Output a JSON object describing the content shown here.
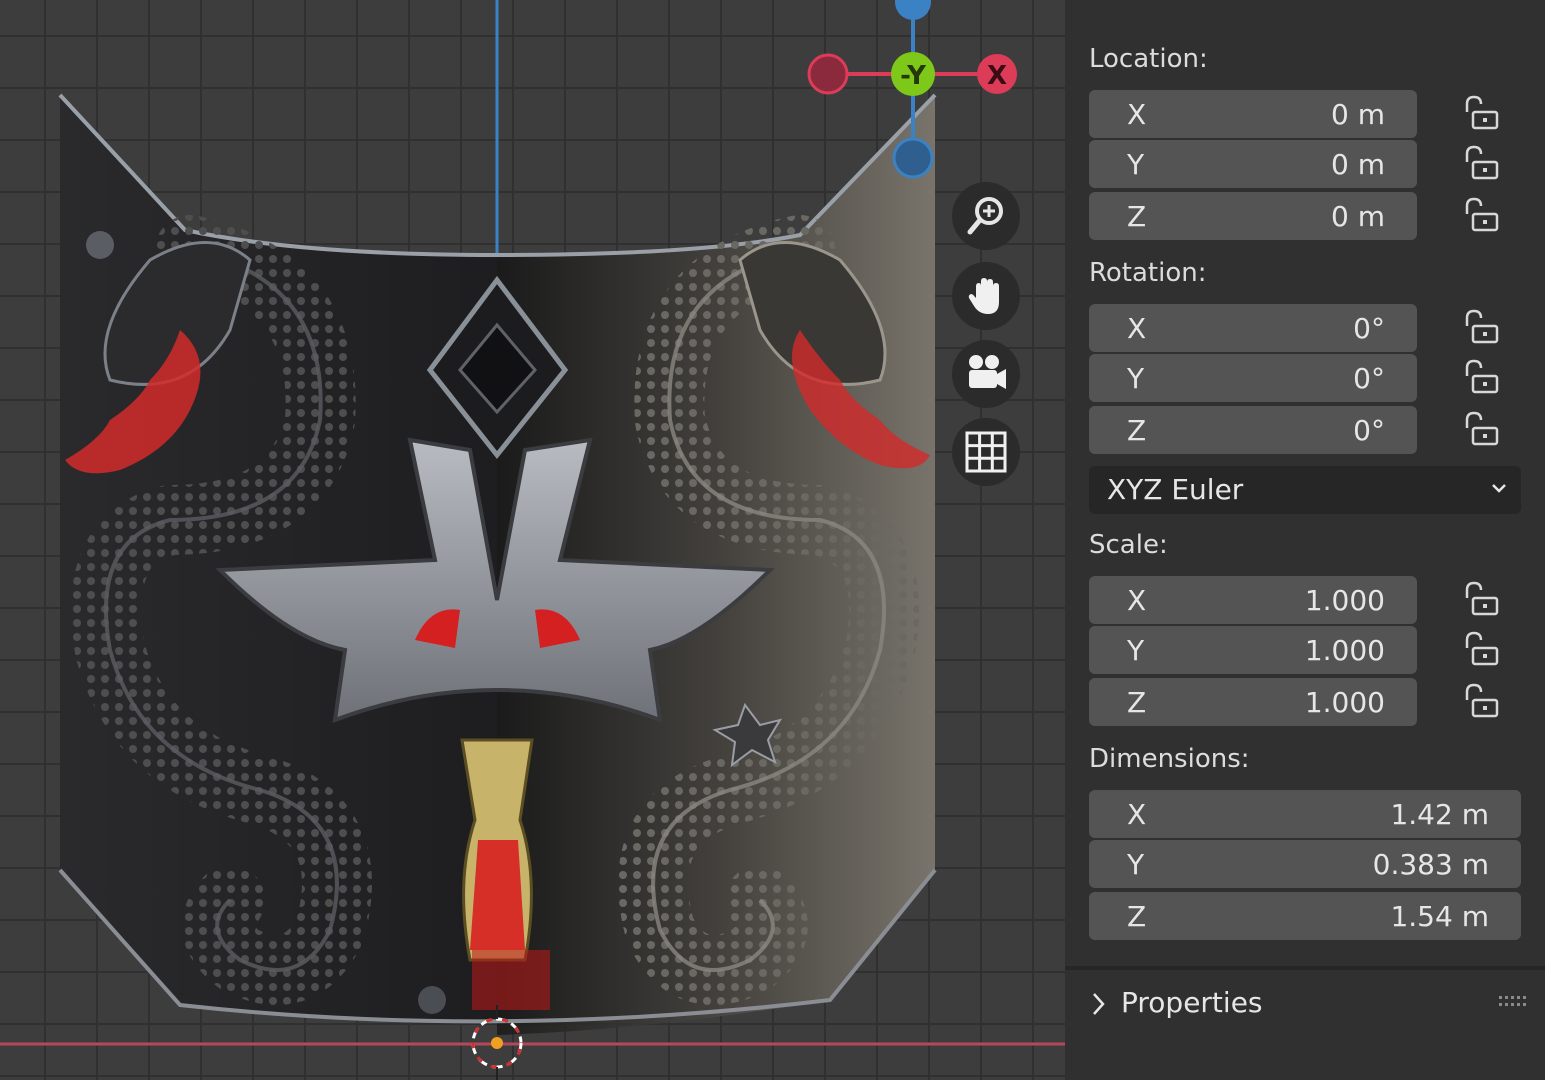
{
  "viewport": {
    "gizmo": {
      "x_label": "X",
      "y_label": "-Y"
    },
    "nav_buttons": [
      {
        "icon": "zoom-icon"
      },
      {
        "icon": "hand-pan-icon"
      },
      {
        "icon": "camera-icon"
      },
      {
        "icon": "grid-icon"
      }
    ],
    "colors": {
      "x_axis": "#dc3c58",
      "y_axis": "#7ec81a",
      "z_axis": "#3b82c4",
      "grid": "#303030",
      "background": "#3d3d3d"
    }
  },
  "panel": {
    "location": {
      "label": "Location:",
      "x": {
        "axis": "X",
        "value": "0 m"
      },
      "y": {
        "axis": "Y",
        "value": "0 m"
      },
      "z": {
        "axis": "Z",
        "value": "0 m"
      }
    },
    "rotation": {
      "label": "Rotation:",
      "x": {
        "axis": "X",
        "value": "0°"
      },
      "y": {
        "axis": "Y",
        "value": "0°"
      },
      "z": {
        "axis": "Z",
        "value": "0°"
      },
      "mode": "XYZ Euler"
    },
    "scale": {
      "label": "Scale:",
      "x": {
        "axis": "X",
        "value": "1.000"
      },
      "y": {
        "axis": "Y",
        "value": "1.000"
      },
      "z": {
        "axis": "Z",
        "value": "1.000"
      }
    },
    "dimensions": {
      "label": "Dimensions:",
      "x": {
        "axis": "X",
        "value": "1.42 m"
      },
      "y": {
        "axis": "Y",
        "value": "0.383 m"
      },
      "z": {
        "axis": "Z",
        "value": "1.54 m"
      }
    },
    "properties_label": "Properties"
  }
}
